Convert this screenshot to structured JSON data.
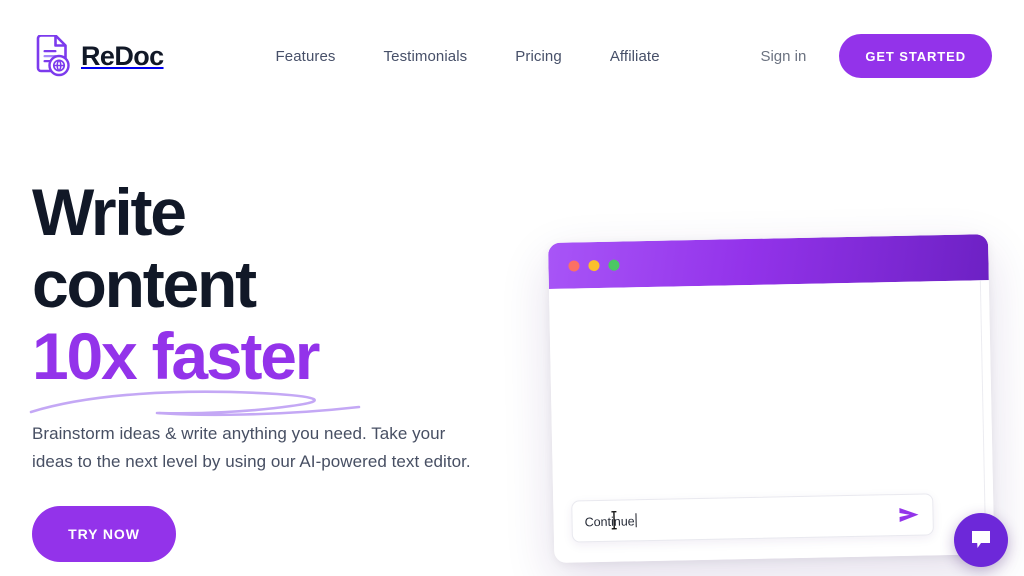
{
  "brand": {
    "name": "ReDoc",
    "logo_icon": "document-globe-icon",
    "accent_color": "#9333ea",
    "heading_color": "#111827"
  },
  "header": {
    "nav": [
      {
        "label": "Features"
      },
      {
        "label": "Testimonials"
      },
      {
        "label": "Pricing"
      },
      {
        "label": "Affiliate"
      }
    ],
    "signin_label": "Sign in",
    "cta_label": "GET STARTED"
  },
  "hero": {
    "headline_line1": "Write",
    "headline_line2": "content",
    "headline_accent": "10x faster",
    "subtext": "Brainstorm ideas & write anything you need. Take your ideas to the next level by using our AI-powered text editor.",
    "cta_label": "TRY NOW"
  },
  "mockup": {
    "window_dots": [
      {
        "name": "close-dot",
        "color": "#fb7065"
      },
      {
        "name": "minimize-dot",
        "color": "#fbc02d"
      },
      {
        "name": "maximize-dot",
        "color": "#4cc764"
      }
    ],
    "titlebar_gradient_from": "#a855f7",
    "titlebar_gradient_to": "#6d21c4",
    "input_value": "Continue",
    "input_placeholder": "Continue",
    "send_icon": "send-arrow-icon"
  },
  "chat_widget": {
    "icon": "chat-bubble-icon",
    "color": "#6d28d9"
  }
}
